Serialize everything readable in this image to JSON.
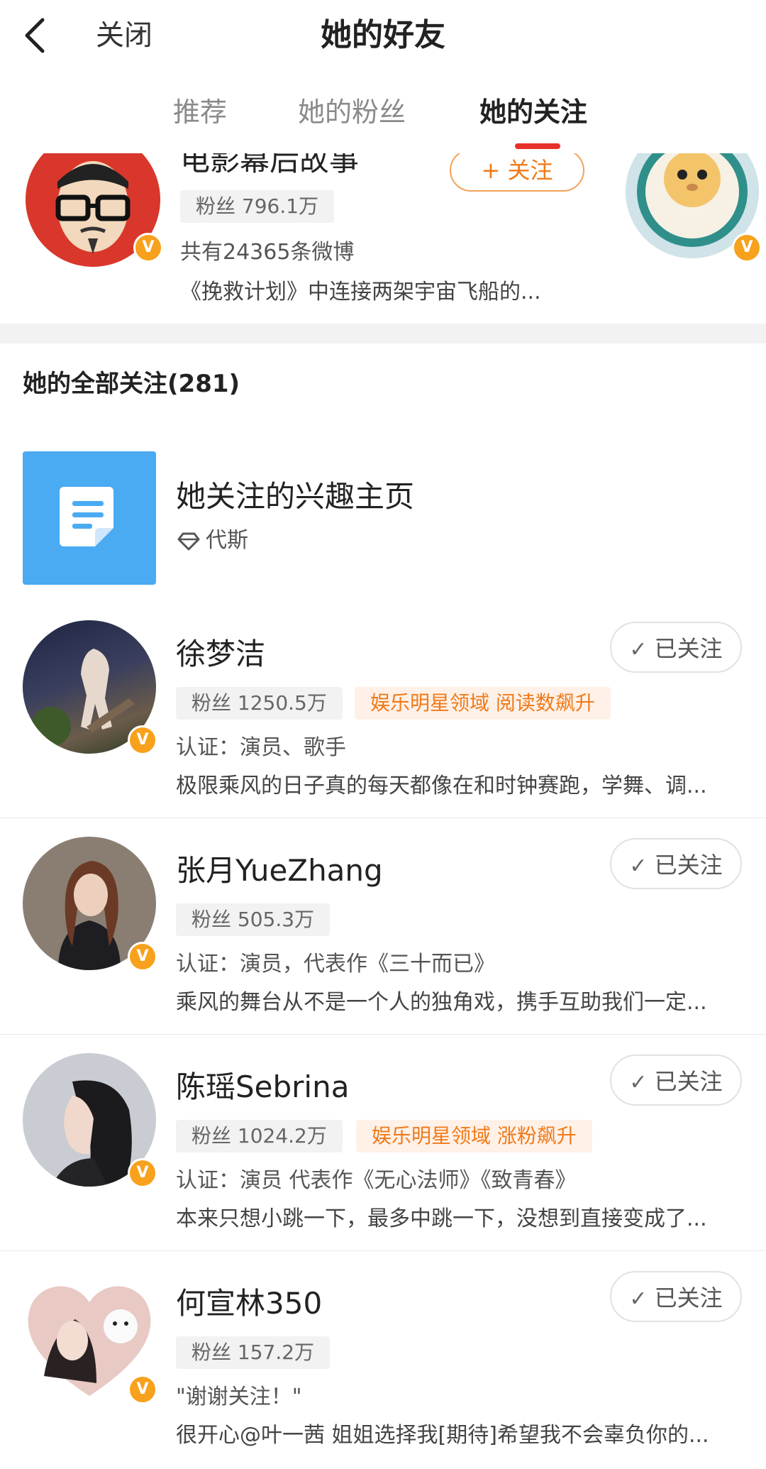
{
  "header": {
    "close_label": "关闭",
    "title": "她的好友"
  },
  "tabs": [
    {
      "label": "推荐",
      "active": false
    },
    {
      "label": "她的粉丝",
      "active": false
    },
    {
      "label": "她的关注",
      "active": true
    }
  ],
  "top_card": {
    "name": "电影幕后故事",
    "follow_label": "+ 关注",
    "fans": "粉丝 796.1万",
    "weibo_count": "共有24365条微博",
    "desc": "《挽救计划》中连接两架宇宙飞船的..."
  },
  "section": {
    "title": "她的全部关注(281)"
  },
  "interest_page": {
    "title": "她关注的兴趣主页",
    "subtitle": "代斯"
  },
  "follow_label": "已关注",
  "users": [
    {
      "name": "徐梦洁",
      "fans": "粉丝 1250.5万",
      "tag": "娱乐明星领域 阅读数飙升",
      "verify": "认证：演员、歌手",
      "desc": "极限乘风的日子真的每天都像在和时钟赛跑，学舞、调..."
    },
    {
      "name": "张月YueZhang",
      "fans": "粉丝 505.3万",
      "tag": "",
      "verify": "认证：演员，代表作《三十而已》",
      "desc": "乘风的舞台从不是一个人的独角戏，携手互助我们一定..."
    },
    {
      "name": "陈瑶Sebrina",
      "fans": "粉丝 1024.2万",
      "tag": "娱乐明星领域 涨粉飙升",
      "verify": "认证：演员 代表作《无心法师》《致青春》",
      "desc": "本来只想小跳一下，最多中跳一下，没想到直接变成了..."
    },
    {
      "name": "何宣林350",
      "fans": "粉丝 157.2万",
      "tag": "",
      "verify": "\"谢谢关注！\"",
      "desc": "很开心@叶一茜 姐姐选择我[期待]希望我不会辜负你的..."
    }
  ],
  "badge_letter": "V",
  "colors": {
    "accent": "#e8312b",
    "badge": "#f7a11c",
    "tag_orange": "#f07a18",
    "interest_blue": "#4aaaf2"
  }
}
